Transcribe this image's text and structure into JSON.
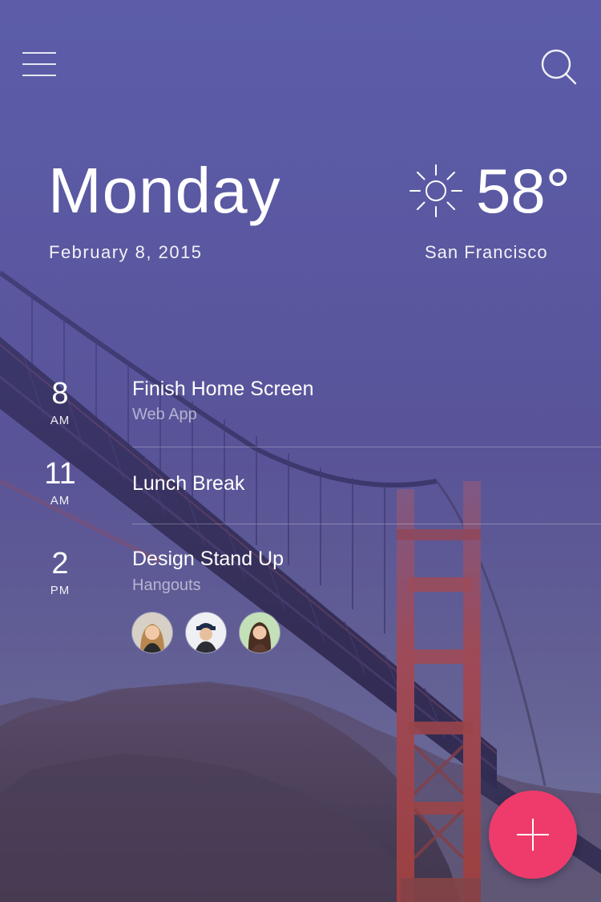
{
  "header": {
    "menu_icon": "hamburger-menu-icon",
    "search_icon": "search-icon"
  },
  "today": {
    "day": "Monday",
    "date": "February 8, 2015"
  },
  "weather": {
    "icon": "sun-icon",
    "temperature": "58°",
    "city": "San Francisco"
  },
  "events": [
    {
      "hour": "8",
      "period": "AM",
      "title": "Finish Home Screen",
      "subtitle": "Web App"
    },
    {
      "hour": "11",
      "period": "AM",
      "title": "Lunch Break",
      "subtitle": ""
    },
    {
      "hour": "2",
      "period": "PM",
      "title": "Design Stand Up",
      "subtitle": "Hangouts",
      "attendees": [
        "avatar-woman-blonde",
        "avatar-man-cap",
        "avatar-woman-brunette"
      ]
    }
  ],
  "fab": {
    "icon": "plus-icon"
  },
  "colors": {
    "accent": "#ee3b6c",
    "background_top": "#5a5ba6",
    "bridge": "#b8403a"
  }
}
